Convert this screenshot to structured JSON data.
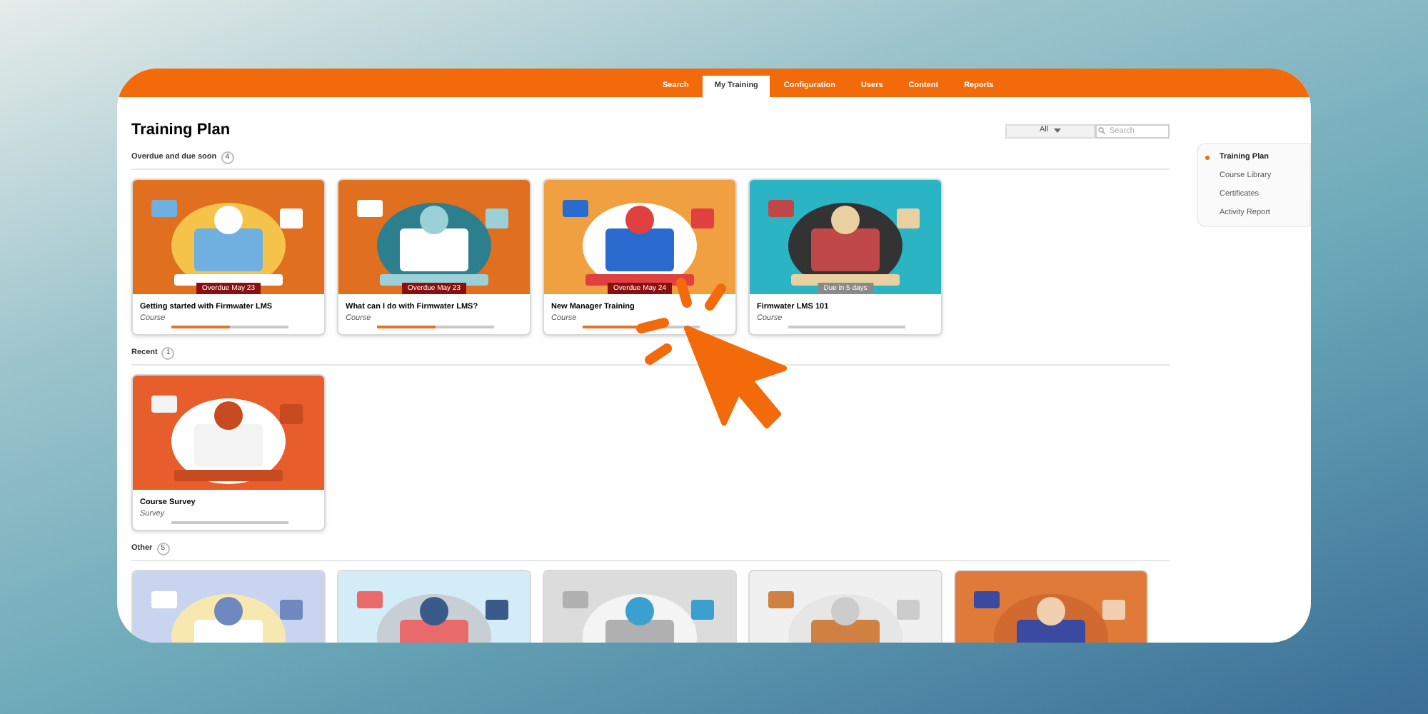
{
  "nav": {
    "tabs": [
      {
        "label": "Search",
        "selected": false
      },
      {
        "label": "My Training",
        "selected": true
      },
      {
        "label": "Configuration",
        "selected": false
      },
      {
        "label": "Users",
        "selected": false
      },
      {
        "label": "Content",
        "selected": false
      },
      {
        "label": "Reports",
        "selected": false
      }
    ]
  },
  "page": {
    "title": "Training Plan",
    "filter": {
      "value": "All"
    },
    "search": {
      "placeholder": "Search"
    }
  },
  "sections": [
    {
      "title": "Overdue and due soon",
      "count": "4",
      "cards": [
        {
          "kind": "course",
          "title": "Getting started with Firmwater LMS",
          "type": "Course",
          "badge": {
            "text": "Overdue May 23",
            "kind": "overdue"
          },
          "level": 0.5
        },
        {
          "kind": "course",
          "title": "What can I do with Firmwater LMS?",
          "type": "Course",
          "badge": {
            "text": "Overdue May 23",
            "kind": "overdue"
          },
          "level": 0.5
        },
        {
          "kind": "course",
          "title": "New Manager Training",
          "type": "Course",
          "badge": {
            "text": "Overdue May 24",
            "kind": "overdue"
          },
          "level": 0.5
        },
        {
          "kind": "course",
          "title": "Firmwater LMS 101",
          "type": "Course",
          "badge": {
            "text": "Due in 5 days",
            "kind": "due"
          }
        }
      ]
    },
    {
      "title": "Recent",
      "count": "1",
      "cards": [
        {
          "kind": "course",
          "title": "Course Survey",
          "type": "Survey"
        }
      ]
    },
    {
      "title": "Other",
      "count": "5"
    }
  ],
  "sidebar": {
    "items": [
      {
        "label": "Training Plan",
        "selected": true
      },
      {
        "label": "Course Library",
        "selected": false
      },
      {
        "label": "Certificates",
        "selected": false
      },
      {
        "label": "Activity Report",
        "selected": false
      }
    ]
  }
}
